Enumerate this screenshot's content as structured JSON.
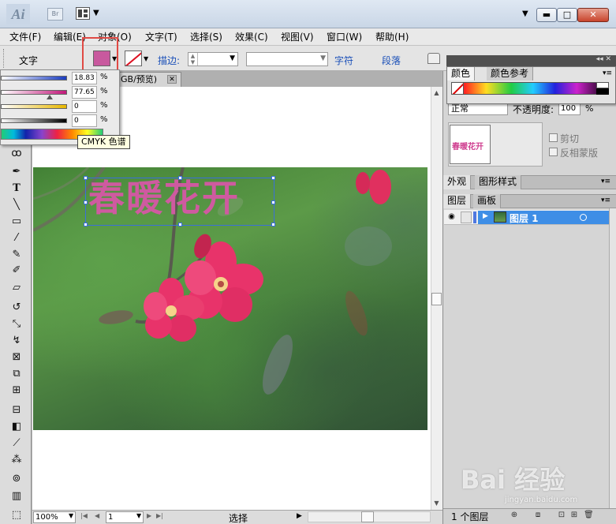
{
  "window": {
    "app_logo": "Ai",
    "bridge_label": "Br",
    "icons": {
      "arrange": "arrange-documents-icon",
      "minimize": "minimize-icon",
      "maximize": "maximize-icon",
      "close": "close-icon"
    },
    "min_glyph": "▬",
    "max_glyph": "□",
    "close_glyph": "✕"
  },
  "menu": [
    "文件(F)",
    "编辑(E)",
    "对象(O)",
    "文字(T)",
    "选择(S)",
    "效果(C)",
    "视图(V)",
    "窗口(W)",
    "帮助(H)"
  ],
  "control_bar": {
    "label": "文字",
    "fill_color": "#c8599e",
    "stroke_label": "描边:",
    "character_link": "字符",
    "paragraph_link": "段落"
  },
  "swatch_popup": {
    "rows": [
      {
        "value": "18.83",
        "unit": "%",
        "gradient": "linear-gradient(90deg,#fff,#1a3cc0)"
      },
      {
        "value": "77.65",
        "unit": "%",
        "gradient": "linear-gradient(90deg,#fff,#c2187a)"
      },
      {
        "value": "0",
        "unit": "%",
        "gradient": "linear-gradient(90deg,#fff,#e8b800)"
      },
      {
        "value": "0",
        "unit": "%",
        "gradient": "linear-gradient(90deg,#fff,#000)"
      }
    ],
    "tooltip": "CMYK 色谱"
  },
  "document": {
    "tab_title": "GB/预览)",
    "close_glyph": "✕",
    "headline": "春暖花开",
    "headline_color": "#cf5aa0"
  },
  "status_bar": {
    "zoom": "100%",
    "page": "1",
    "tool_status": "选择"
  },
  "color_panel": {
    "tab_color": "颜色",
    "tab_color_ref": "颜色参考",
    "blend_mode": "正常",
    "opacity_label": "不透明度:",
    "opacity_value": "100",
    "opacity_unit": "%",
    "thumb_text": "春暖花开",
    "clip_label": "剪切",
    "invert_label": "反相蒙版"
  },
  "appearance_panel": {
    "tab_appearance": "外观",
    "tab_graphic_styles": "图形样式"
  },
  "layers_panel": {
    "tab_layers": "图层",
    "tab_artboards": "画板",
    "layer_name": "图层 1",
    "layer_count": "1 个图层"
  },
  "watermark": {
    "text": "Bai 经验",
    "sub": "jingyan.baidu.com"
  }
}
